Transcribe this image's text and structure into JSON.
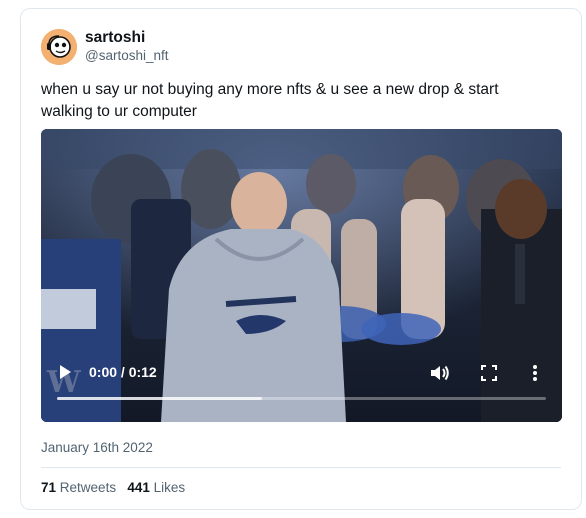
{
  "tweet": {
    "author_name": "sartoshi",
    "author_handle": "@sartoshi_nft",
    "text": "when u say ur not buying any more nfts & u see a new drop & start walking to ur computer",
    "date": "January 16th 2022"
  },
  "video": {
    "time_display": "0:00 / 0:12",
    "watermark": "W",
    "buffered_fraction": 0.42,
    "icons": [
      "play-icon",
      "volume-icon",
      "fullscreen-icon",
      "more-options-icon"
    ]
  },
  "stats": {
    "retweets_count": "71",
    "retweets_label": "Retweets",
    "likes_count": "441",
    "likes_label": "Likes"
  },
  "colors": {
    "text_primary": "#0f1419",
    "text_secondary": "#536471",
    "border": "#e1e8ed",
    "avatar_bg": "#f3b071"
  }
}
